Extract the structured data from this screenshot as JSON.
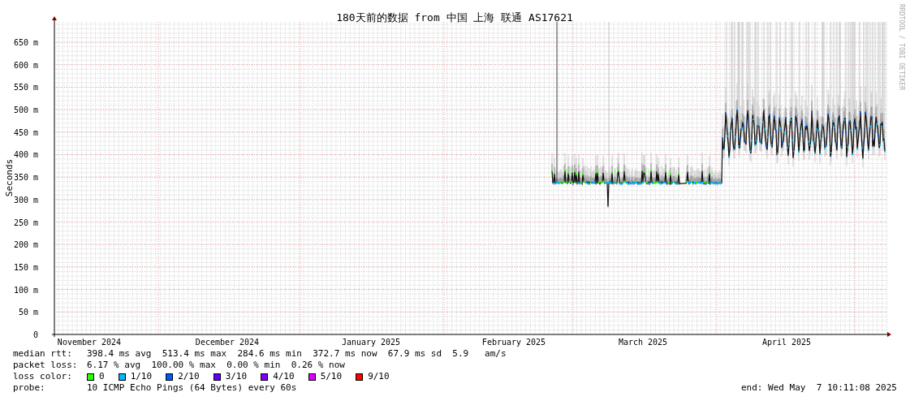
{
  "title": "180天前的数据 from 中国 上海 联通 AS17621",
  "y_axis": {
    "label": "Seconds",
    "ticks": [
      "650 m",
      "600 m",
      "550 m",
      "500 m",
      "450 m",
      "400 m",
      "350 m",
      "300 m",
      "250 m",
      "200 m",
      "150 m",
      "100 m",
      "50 m",
      "0"
    ]
  },
  "x_axis": {
    "ticks": [
      "November 2024",
      "December 2024",
      "January 2025",
      "February 2025",
      "March 2025",
      "April 2025"
    ]
  },
  "credit": "RRDTOOL / TOBI OETIKER",
  "median_rtt": {
    "label": "median rtt:",
    "text": "398.4 ms avg  513.4 ms max  284.6 ms min  372.7 ms now  67.9 ms sd  5.9   am/s"
  },
  "packet_loss": {
    "label": "packet loss:",
    "text": "6.17 % avg  100.00 % max  0.00 % min  0.26 % now"
  },
  "loss_color": {
    "label": "loss color:",
    "items": [
      {
        "label": "0",
        "color": "#26ff00"
      },
      {
        "label": "1/10",
        "color": "#00b8ff"
      },
      {
        "label": "2/10",
        "color": "#0059ff"
      },
      {
        "label": "3/10",
        "color": "#5e00ff"
      },
      {
        "label": "4/10",
        "color": "#7e00ff"
      },
      {
        "label": "5/10",
        "color": "#dd00ff"
      },
      {
        "label": "9/10",
        "color": "#ff0000"
      }
    ]
  },
  "probe": {
    "label": "probe:",
    "text": "10 ICMP Echo Pings (64 Bytes) every 60s"
  },
  "end": "end: Wed May  7 10:11:08 2025"
}
